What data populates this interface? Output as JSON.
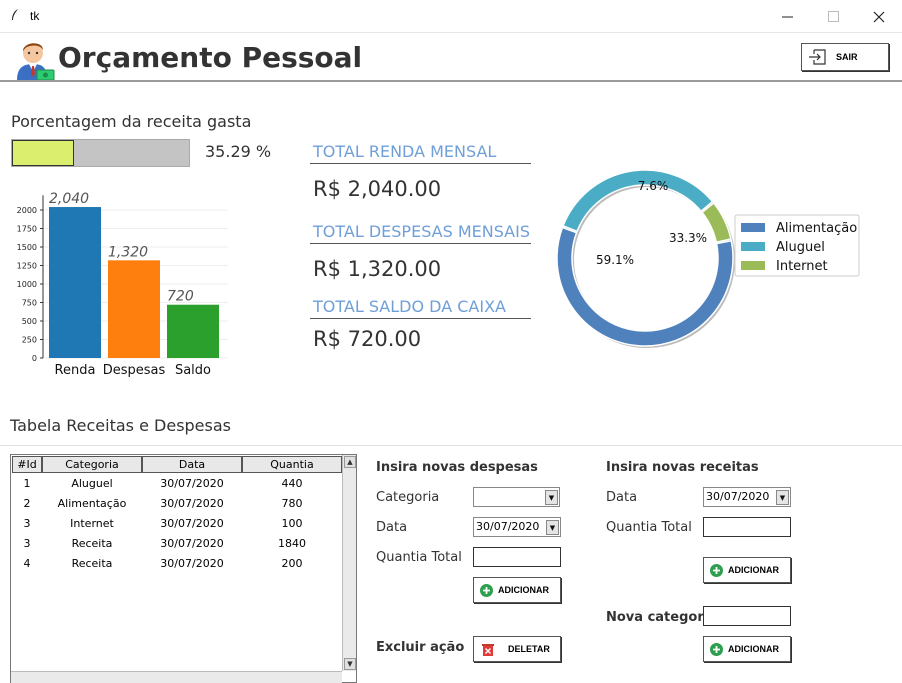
{
  "window": {
    "title": "tk"
  },
  "header": {
    "title": "Orçamento Pessoal",
    "exit_label": "SAIR"
  },
  "progress": {
    "label": "Porcentagem da receita gasta",
    "percent": 35.29,
    "text": "35.29 %"
  },
  "bar_chart_data": {
    "type": "bar",
    "categories": [
      "Renda",
      "Despesas",
      "Saldo"
    ],
    "values": [
      2040,
      1320,
      720
    ],
    "value_labels": [
      "2,040",
      "1,320",
      "720"
    ],
    "colors": [
      "#1f77b4",
      "#ff7f0e",
      "#2ca02c"
    ],
    "yticks": [
      "0",
      "250",
      "500",
      "750",
      "1000",
      "1250",
      "1500",
      "1750",
      "2000"
    ],
    "ylim": [
      0,
      2200
    ],
    "grid": true
  },
  "totals": {
    "renda": {
      "label": "TOTAL RENDA MENSAL",
      "value": "R$ 2,040.00"
    },
    "despesas": {
      "label": "TOTAL DESPESAS MENSAIS",
      "value": "R$ 1,320.00"
    },
    "saldo": {
      "label": "TOTAL SALDO DA CAIXA",
      "value": "R$ 720.00"
    }
  },
  "chart_data": {
    "type": "pie",
    "categories": [
      "Alimentação",
      "Aluguel",
      "Internet"
    ],
    "values": [
      59.1,
      33.3,
      7.6
    ],
    "value_labels": [
      "59.1%",
      "33.3%",
      "7.6%"
    ],
    "colors": [
      "#4f81bd",
      "#4bacc6",
      "#9bbb59"
    ],
    "legend_placement": "right"
  },
  "table": {
    "section_label": "Tabela Receitas e Despesas",
    "columns": [
      "#Id",
      "Categoria",
      "Data",
      "Quantia"
    ],
    "rows": [
      [
        "1",
        "Aluguel",
        "30/07/2020",
        "440"
      ],
      [
        "2",
        "Alimentação",
        "30/07/2020",
        "780"
      ],
      [
        "3",
        "Internet",
        "30/07/2020",
        "100"
      ],
      [
        "3",
        "Receita",
        "30/07/2020",
        "1840"
      ],
      [
        "4",
        "Receita",
        "30/07/2020",
        "200"
      ]
    ]
  },
  "despesas_form": {
    "title": "Insira novas despesas",
    "categoria_label": "Categoria",
    "categoria_value": "",
    "data_label": "Data",
    "data_value": "30/07/2020",
    "quantia_label": "Quantia Total",
    "quantia_value": "",
    "add_label": "ADICIONAR"
  },
  "excluir": {
    "label": "Excluir ação",
    "delete_label": "DELETAR"
  },
  "receitas_form": {
    "title": "Insira novas receitas",
    "data_label": "Data",
    "data_value": "30/07/2020",
    "quantia_label": "Quantia Total",
    "quantia_value": "",
    "add_label": "ADICIONAR"
  },
  "categoria_form": {
    "label": "Nova categoria",
    "value": "",
    "add_label": "ADICIONAR"
  }
}
